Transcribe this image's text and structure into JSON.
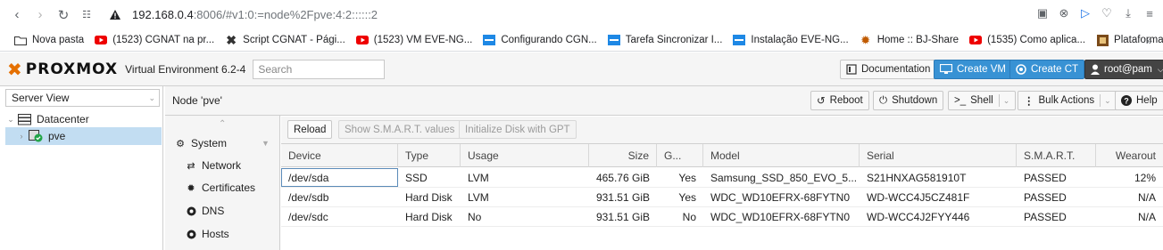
{
  "browser": {
    "url_host": "192.168.0.4",
    "url_rest": ":8006/#v1:0:=node%2Fpve:4:2::::::2",
    "bookmarks": [
      {
        "label": "Nova pasta",
        "icon": "folder-icon"
      },
      {
        "label": "(1523) CGNAT na pr...",
        "icon": "youtube-icon"
      },
      {
        "label": "Script CGNAT - Pági...",
        "icon": "x-logo-icon"
      },
      {
        "label": "(1523) VM EVE-NG...",
        "icon": "youtube-icon"
      },
      {
        "label": "Configurando CGN...",
        "icon": "eve-icon"
      },
      {
        "label": "Tarefa Sincronizar I...",
        "icon": "eve-icon"
      },
      {
        "label": "Instalação EVE-NG...",
        "icon": "eve-icon"
      },
      {
        "label": "Home :: BJ-Share",
        "icon": "bj-icon"
      },
      {
        "label": "(1535) Como aplica...",
        "icon": "youtube-icon"
      },
      {
        "label": "Plataforma EAD Cri...",
        "icon": "ead-icon"
      }
    ]
  },
  "header": {
    "logo": "PROXMOX",
    "version": "Virtual Environment 6.2-4",
    "search_placeholder": "Search",
    "documentation": "Documentation",
    "create_vm": "Create VM",
    "create_ct": "Create CT",
    "user": "root@pam"
  },
  "tree": {
    "view": "Server View",
    "datacenter": "Datacenter",
    "node": "pve"
  },
  "node": {
    "title": "Node 'pve'",
    "reboot": "Reboot",
    "shutdown": "Shutdown",
    "shell": "Shell",
    "bulk_actions": "Bulk Actions",
    "help": "Help"
  },
  "menu": {
    "system": "System",
    "network": "Network",
    "certificates": "Certificates",
    "dns": "DNS",
    "hosts": "Hosts"
  },
  "toolbar": {
    "reload": "Reload",
    "smart": "Show S.M.A.R.T. values",
    "init_gpt": "Initialize Disk with GPT"
  },
  "disks": {
    "columns": [
      "Device",
      "Type",
      "Usage",
      "Size",
      "G...",
      "Model",
      "Serial",
      "S.M.A.R.T.",
      "Wearout"
    ],
    "rows": [
      [
        "/dev/sda",
        "SSD",
        "LVM",
        "465.76 GiB",
        "Yes",
        "Samsung_SSD_850_EVO_5...",
        "S21HNXAG581910T",
        "PASSED",
        "12%"
      ],
      [
        "/dev/sdb",
        "Hard Disk",
        "LVM",
        "931.51 GiB",
        "Yes",
        "WDC_WD10EFRX-68FYTN0",
        "WD-WCC4J5CZ481F",
        "PASSED",
        "N/A"
      ],
      [
        "/dev/sdc",
        "Hard Disk",
        "No",
        "931.51 GiB",
        "No",
        "WDC_WD10EFRX-68FYTN0",
        "WD-WCC4J2FYY446",
        "PASSED",
        "N/A"
      ]
    ]
  }
}
